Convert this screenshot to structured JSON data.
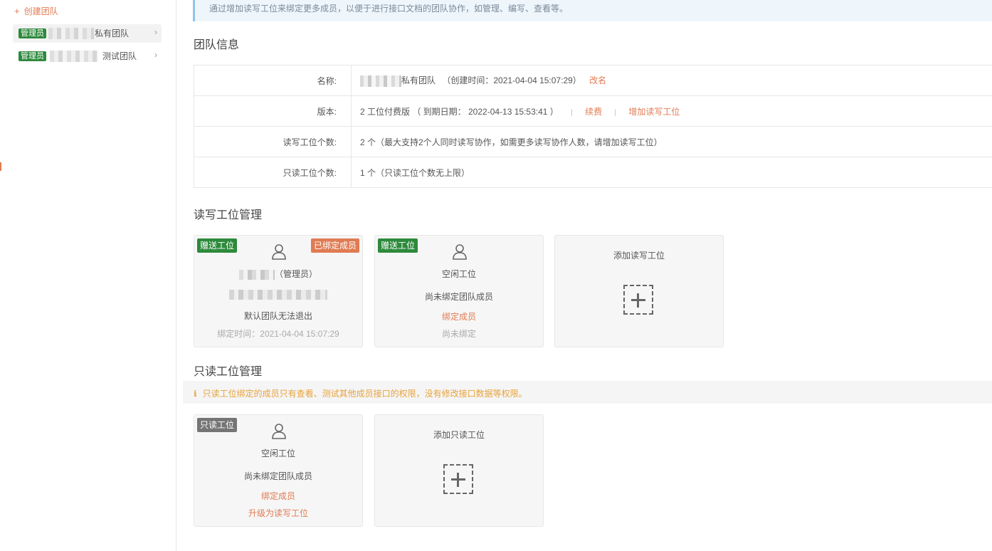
{
  "sidebar": {
    "create_team": "创建团队",
    "teams": [
      {
        "badge": "管理员",
        "name": "私有团队"
      },
      {
        "badge": "管理员",
        "name": "测试团队"
      }
    ]
  },
  "notice": "通过增加读写工位来绑定更多成员，以便于进行接口文档的团队协作，如管理、编写、查看等。",
  "team_info": {
    "title": "团队信息",
    "rows": {
      "name": {
        "label": "名称:",
        "value": "私有团队",
        "created": "（创建时间：2021-04-04 15:07:29）",
        "action": "改名"
      },
      "version": {
        "label": "版本:",
        "value": "2 工位付费版 （ 到期日期： 2022-04-13 15:53:41 ）",
        "renew": "续费",
        "add_rw": "增加读写工位"
      },
      "rw_count": {
        "label": "读写工位个数:",
        "value": "2 个（最大支持2个人同时读写协作，如需更多读写协作人数，请增加读写工位）"
      },
      "ro_count": {
        "label": "只读工位个数:",
        "value": "1 个（只读工位个数无上限）"
      }
    }
  },
  "rw_section": {
    "title": "读写工位管理",
    "cards": [
      {
        "tag": "赠送工位",
        "status_tag": "已绑定成员",
        "role": "（管理员）",
        "note": "默认团队无法退出",
        "bound_time": "绑定时间：2021-04-04 15:07:29"
      },
      {
        "tag": "赠送工位",
        "title": "空闲工位",
        "desc": "尚未绑定团队成员",
        "action": "绑定成员",
        "status": "尚未绑定"
      }
    ],
    "add_label": "添加读写工位"
  },
  "ro_section": {
    "title": "只读工位管理",
    "warning": "只读工位绑定的成员只有查看、测试其他成员接口的权限，没有修改接口数据等权限。",
    "cards": [
      {
        "tag": "只读工位",
        "title": "空闲工位",
        "desc": "尚未绑定团队成员",
        "action": "绑定成员",
        "upgrade": "升级为读写工位"
      }
    ],
    "add_label": "添加只读工位"
  },
  "colors": {
    "accent": "#e07b53",
    "green": "#2d8a3b",
    "gray_tag": "#757575"
  },
  "icons": [
    "plus-icon",
    "chevron-right-icon",
    "user-icon",
    "info-icon",
    "add-box-icon"
  ]
}
